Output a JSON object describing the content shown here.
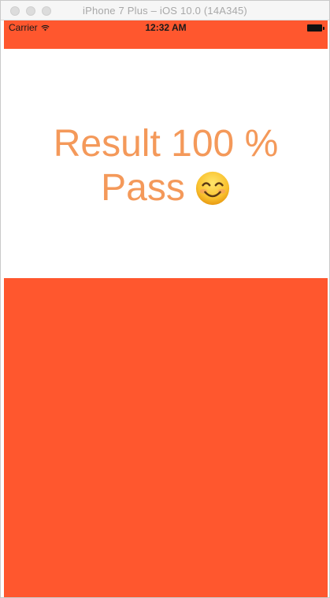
{
  "window": {
    "title": "iPhone 7 Plus – iOS 10.0 (14A345)"
  },
  "status_bar": {
    "carrier": "Carrier",
    "time": "12:32 AM"
  },
  "result": {
    "line1": "Result 100 %",
    "line2": "Pass"
  },
  "icons": {
    "wifi": "wifi-icon",
    "battery": "battery-icon",
    "smiley": "smiling-face-icon"
  },
  "colors": {
    "accent": "#ff572e",
    "result_text": "#f4995a"
  }
}
